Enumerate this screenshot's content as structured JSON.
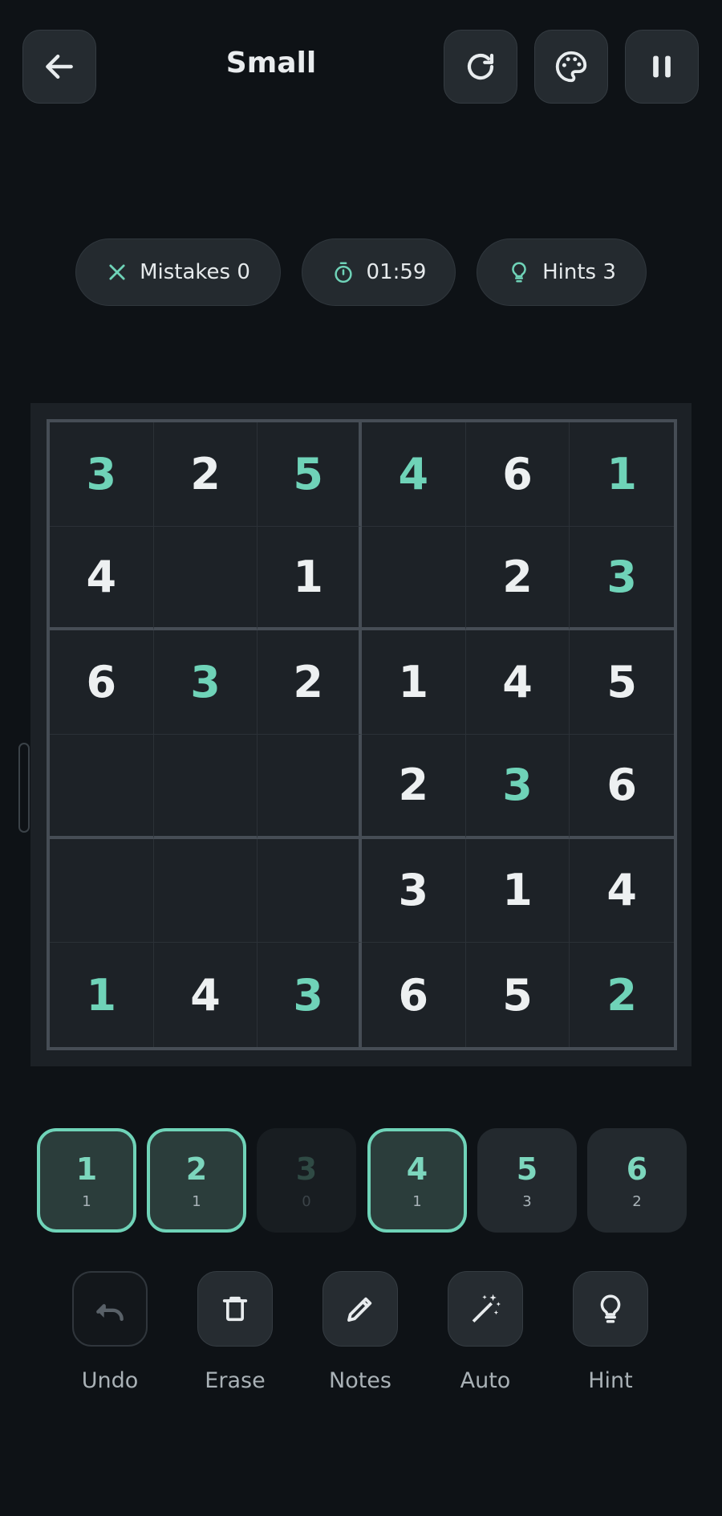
{
  "header": {
    "title": "Small",
    "back_icon": "arrow-left-icon",
    "actions": [
      "restart-icon",
      "palette-icon",
      "pause-icon"
    ]
  },
  "stats": {
    "mistakes_label": "Mistakes 0",
    "timer": "01:59",
    "hints_label": "Hints 3"
  },
  "board": {
    "size": 6,
    "rows": [
      [
        {
          "v": "3",
          "t": "user"
        },
        {
          "v": "2",
          "t": "given"
        },
        {
          "v": "5",
          "t": "user"
        },
        {
          "v": "4",
          "t": "user"
        },
        {
          "v": "6",
          "t": "given"
        },
        {
          "v": "1",
          "t": "user"
        }
      ],
      [
        {
          "v": "4",
          "t": "given"
        },
        {
          "v": "",
          "t": "empty"
        },
        {
          "v": "1",
          "t": "given"
        },
        {
          "v": "",
          "t": "empty"
        },
        {
          "v": "2",
          "t": "given"
        },
        {
          "v": "3",
          "t": "user"
        }
      ],
      [
        {
          "v": "6",
          "t": "given"
        },
        {
          "v": "3",
          "t": "user"
        },
        {
          "v": "2",
          "t": "given"
        },
        {
          "v": "1",
          "t": "given"
        },
        {
          "v": "4",
          "t": "given"
        },
        {
          "v": "5",
          "t": "given"
        }
      ],
      [
        {
          "v": "",
          "t": "empty"
        },
        {
          "v": "",
          "t": "empty"
        },
        {
          "v": "",
          "t": "empty"
        },
        {
          "v": "2",
          "t": "given"
        },
        {
          "v": "3",
          "t": "user"
        },
        {
          "v": "6",
          "t": "given"
        }
      ],
      [
        {
          "v": "",
          "t": "empty"
        },
        {
          "v": "",
          "t": "empty"
        },
        {
          "v": "",
          "t": "empty"
        },
        {
          "v": "3",
          "t": "given"
        },
        {
          "v": "1",
          "t": "given"
        },
        {
          "v": "4",
          "t": "given"
        }
      ],
      [
        {
          "v": "1",
          "t": "user"
        },
        {
          "v": "4",
          "t": "given"
        },
        {
          "v": "3",
          "t": "user"
        },
        {
          "v": "6",
          "t": "given"
        },
        {
          "v": "5",
          "t": "given"
        },
        {
          "v": "2",
          "t": "user"
        }
      ]
    ]
  },
  "numpad": [
    {
      "digit": "1",
      "count": "1",
      "state": "active"
    },
    {
      "digit": "2",
      "count": "1",
      "state": "active"
    },
    {
      "digit": "3",
      "count": "0",
      "state": "done"
    },
    {
      "digit": "4",
      "count": "1",
      "state": "active"
    },
    {
      "digit": "5",
      "count": "3",
      "state": "normal"
    },
    {
      "digit": "6",
      "count": "2",
      "state": "normal"
    }
  ],
  "tools": {
    "undo": "Undo",
    "erase": "Erase",
    "notes": "Notes",
    "auto": "Auto",
    "hint": "Hint"
  },
  "colors": {
    "accent": "#6fd3b8",
    "background": "#0e1216",
    "given_digit": "#edf0f1"
  }
}
